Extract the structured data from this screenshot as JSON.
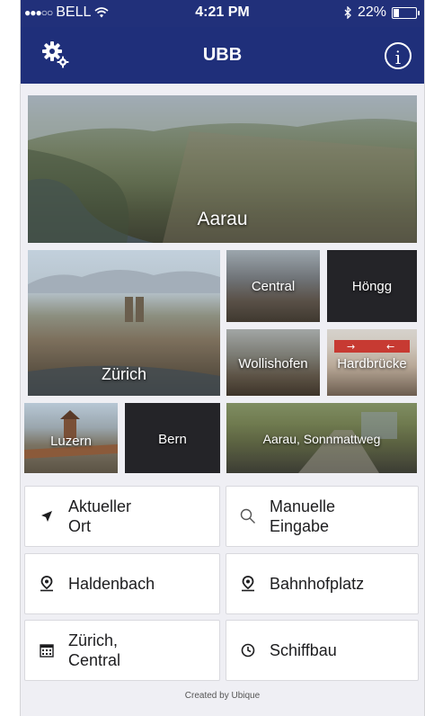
{
  "status": {
    "carrier": "BELL",
    "time": "4:21 PM",
    "battery": "22%"
  },
  "header": {
    "title": "UBB"
  },
  "tiles": [
    {
      "label": "Aarau"
    },
    {
      "label": "Zürich"
    },
    {
      "label": "Central"
    },
    {
      "label": "Höngg"
    },
    {
      "label": "Wollishofen"
    },
    {
      "label": "Hardbrücke"
    },
    {
      "label": "Luzern"
    },
    {
      "label": "Bern"
    },
    {
      "label": "Aarau, Sonnmattweg"
    }
  ],
  "actions": [
    {
      "line1": "Aktueller",
      "line2": "Ort",
      "icon": "location-arrow-icon"
    },
    {
      "line1": "Manuelle",
      "line2": "Eingabe",
      "icon": "search-icon"
    },
    {
      "line1": "Haldenbach",
      "line2": "",
      "icon": "map-pin-icon"
    },
    {
      "line1": "Bahnhofplatz",
      "line2": "",
      "icon": "map-pin-icon"
    },
    {
      "line1": "Zürich,",
      "line2": "Central",
      "icon": "calendar-icon"
    },
    {
      "line1": "Schiffbau",
      "line2": "",
      "icon": "clock-icon"
    }
  ],
  "footer": {
    "text": "Created by Ubique"
  }
}
